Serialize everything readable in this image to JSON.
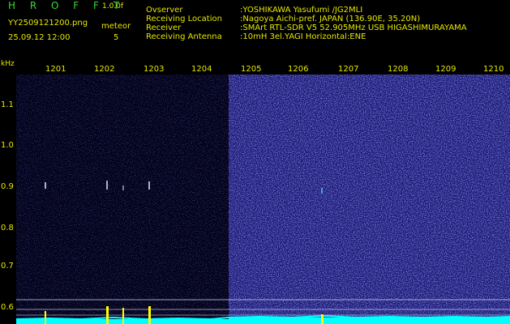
{
  "header": {
    "app_title": "H R O F F T",
    "version": "1.0.0f",
    "filename": "YY2509121200.png",
    "meteor_label": "meteor",
    "timestamp": "25.09.12 12:00",
    "meteor_count": "5"
  },
  "station": [
    {
      "key": "Ovserver",
      "value": ":YOSHIKAWA Yasufumi /JG2MLI"
    },
    {
      "key": "Receiving Location",
      "value": ":Nagoya Aichi-pref. JAPAN (136.90E, 35.20N)"
    },
    {
      "key": "Receiver",
      "value": ":SMArt RTL-SDR V5 52.905MHz USB HIGASHIMURAYAMA"
    },
    {
      "key": "Receiving Antenna",
      "value": ":10mH 3el.YAGI Horizontal:ENE"
    }
  ],
  "axis": {
    "freq_unit": "kHz",
    "freq_labels": [
      "1.1",
      "1.0",
      "0.9",
      "0.8",
      "0.7",
      "0.6"
    ],
    "time_labels": [
      "1201",
      "1202",
      "1203",
      "1204",
      "1205",
      "1206",
      "1207",
      "1208",
      "1209",
      "1210"
    ]
  },
  "colors": {
    "background": "#000000",
    "text_yellow": "#e7e700",
    "text_green": "#38d838",
    "noise_blue": "#2a2aa6",
    "signal_cyan": "#00ffff",
    "meteor_yellow": "#ffff00"
  }
}
